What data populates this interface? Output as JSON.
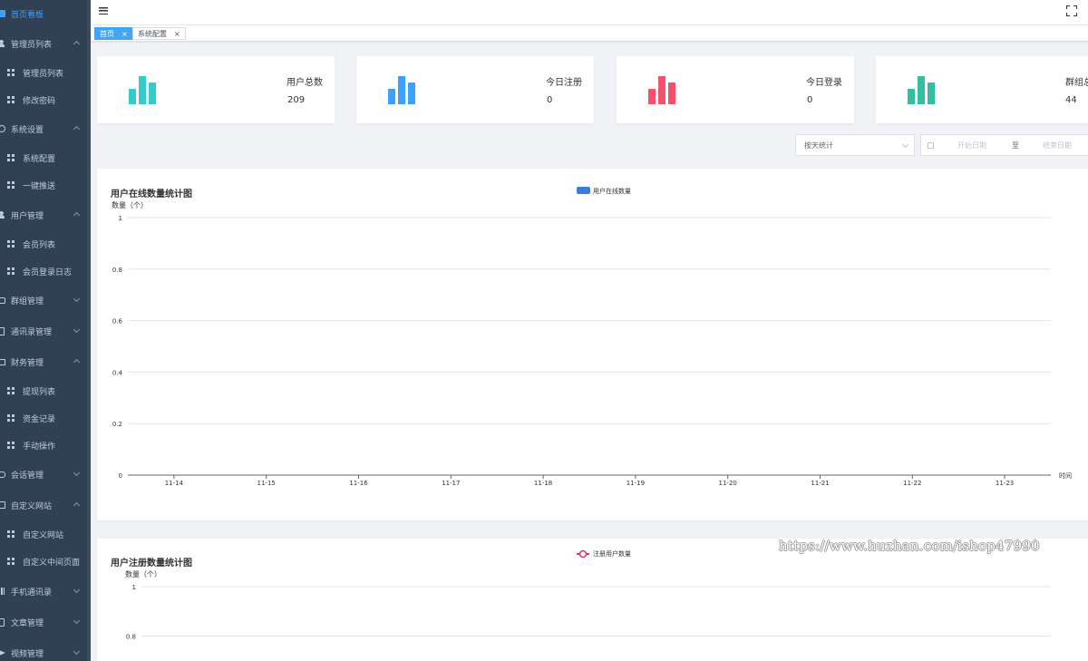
{
  "sidebar": {
    "items": [
      {
        "label": "首页看板",
        "icon": "dashboard-icon",
        "level": 0,
        "active": true
      },
      {
        "label": "管理员列表",
        "icon": "user-icon",
        "level": 0,
        "caret": "up"
      },
      {
        "label": "管理员列表",
        "icon": "grid-icon",
        "level": 1
      },
      {
        "label": "修改密码",
        "icon": "grid-icon",
        "level": 1
      },
      {
        "label": "系统设置",
        "icon": "gear-icon",
        "level": 0,
        "caret": "up"
      },
      {
        "label": "系统配置",
        "icon": "grid-icon",
        "level": 1
      },
      {
        "label": "一键推送",
        "icon": "grid-icon",
        "level": 1
      },
      {
        "label": "用户管理",
        "icon": "user-icon",
        "level": 0,
        "caret": "up"
      },
      {
        "label": "会员列表",
        "icon": "grid-icon",
        "level": 1
      },
      {
        "label": "会员登录日志",
        "icon": "grid-icon",
        "level": 1
      },
      {
        "label": "群组管理",
        "icon": "group-icon",
        "level": 0,
        "caret": "down"
      },
      {
        "label": "通讯录管理",
        "icon": "contacts-icon",
        "level": 0,
        "caret": "down"
      },
      {
        "label": "财务管理",
        "icon": "finance-icon",
        "level": 0,
        "caret": "up"
      },
      {
        "label": "提现列表",
        "icon": "grid-icon",
        "level": 1
      },
      {
        "label": "资金记录",
        "icon": "grid-icon",
        "level": 1
      },
      {
        "label": "手动操作",
        "icon": "grid-icon",
        "level": 1
      },
      {
        "label": "会话管理",
        "icon": "chat-icon",
        "level": 0,
        "caret": "down"
      },
      {
        "label": "自定义网站",
        "icon": "website-icon",
        "level": 0,
        "caret": "up"
      },
      {
        "label": "自定义网站",
        "icon": "grid-icon",
        "level": 1
      },
      {
        "label": "自定义中间页面",
        "icon": "grid-icon",
        "level": 1
      },
      {
        "label": "手机通讯录",
        "icon": "phone-contacts-icon",
        "level": 0,
        "caret": "down"
      },
      {
        "label": "文章管理",
        "icon": "article-icon",
        "level": 0,
        "caret": "down"
      },
      {
        "label": "视频管理",
        "icon": "video-icon",
        "level": 0,
        "caret": "down"
      }
    ]
  },
  "navbar": {
    "menu_icon": "hamburger-icon",
    "fullscreen_icon": "fullscreen-icon"
  },
  "tags": [
    {
      "label": "首页",
      "active": true
    },
    {
      "label": "系统配置",
      "active": false
    }
  ],
  "tag_close": "×",
  "stats": [
    {
      "title": "用户总数",
      "value": "209",
      "color": "#36cbcb"
    },
    {
      "title": "今日注册",
      "value": "0",
      "color": "#3aa1ff"
    },
    {
      "title": "今日登录",
      "value": "0",
      "color": "#f4516c"
    },
    {
      "title": "群组总",
      "value": "44",
      "color": "#34bfa3"
    }
  ],
  "filters": {
    "stat_mode": "按天统计",
    "start_placeholder": "开始日期",
    "separator": "至",
    "end_placeholder": "结束日期"
  },
  "charts": {
    "online": {
      "title": "用户在线数量统计图",
      "legend": "用户在线数量",
      "ylabel": "数量（个）",
      "xlabel": "时间",
      "color": "#3b7ddd"
    },
    "register": {
      "title": "用户注册数量统计图",
      "legend": "注册用户数量",
      "ylabel": "数量（个）",
      "color": "#e5326d"
    }
  },
  "chart_data": [
    {
      "type": "bar",
      "title": "用户在线数量统计图",
      "xlabel": "时间",
      "ylabel": "数量（个）",
      "categories": [
        "11-14",
        "11-15",
        "11-16",
        "11-17",
        "11-18",
        "11-19",
        "11-20",
        "11-21",
        "11-22",
        "11-23"
      ],
      "series": [
        {
          "name": "用户在线数量",
          "values": [
            0,
            0,
            0,
            0,
            0,
            0,
            0,
            0,
            0,
            0
          ]
        }
      ],
      "ylim": [
        0,
        1
      ],
      "yticks": [
        "0",
        "0.2",
        "0.4",
        "0.6",
        "0.8",
        "1"
      ],
      "grid": true,
      "legend": "top-center"
    },
    {
      "type": "line",
      "title": "用户注册数量统计图",
      "ylabel": "数量（个）",
      "series": [
        {
          "name": "注册用户数量",
          "values": []
        }
      ],
      "ylim": [
        0,
        1
      ],
      "yticks": [
        "1",
        "0.8"
      ],
      "grid": true,
      "legend": "top-center"
    }
  ],
  "watermark": "https://www.huzhan.com/ishop47990"
}
